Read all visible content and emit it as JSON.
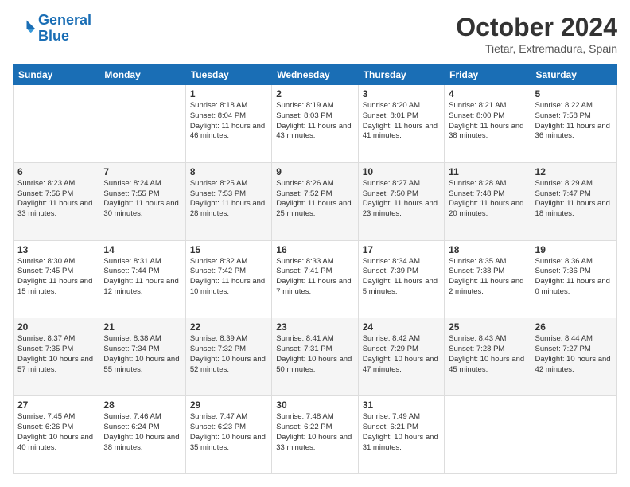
{
  "header": {
    "logo_line1": "General",
    "logo_line2": "Blue",
    "month_title": "October 2024",
    "subtitle": "Tietar, Extremadura, Spain"
  },
  "weekdays": [
    "Sunday",
    "Monday",
    "Tuesday",
    "Wednesday",
    "Thursday",
    "Friday",
    "Saturday"
  ],
  "weeks": [
    [
      {
        "day": "",
        "content": ""
      },
      {
        "day": "",
        "content": ""
      },
      {
        "day": "1",
        "content": "Sunrise: 8:18 AM\nSunset: 8:04 PM\nDaylight: 11 hours and 46 minutes."
      },
      {
        "day": "2",
        "content": "Sunrise: 8:19 AM\nSunset: 8:03 PM\nDaylight: 11 hours and 43 minutes."
      },
      {
        "day": "3",
        "content": "Sunrise: 8:20 AM\nSunset: 8:01 PM\nDaylight: 11 hours and 41 minutes."
      },
      {
        "day": "4",
        "content": "Sunrise: 8:21 AM\nSunset: 8:00 PM\nDaylight: 11 hours and 38 minutes."
      },
      {
        "day": "5",
        "content": "Sunrise: 8:22 AM\nSunset: 7:58 PM\nDaylight: 11 hours and 36 minutes."
      }
    ],
    [
      {
        "day": "6",
        "content": "Sunrise: 8:23 AM\nSunset: 7:56 PM\nDaylight: 11 hours and 33 minutes."
      },
      {
        "day": "7",
        "content": "Sunrise: 8:24 AM\nSunset: 7:55 PM\nDaylight: 11 hours and 30 minutes."
      },
      {
        "day": "8",
        "content": "Sunrise: 8:25 AM\nSunset: 7:53 PM\nDaylight: 11 hours and 28 minutes."
      },
      {
        "day": "9",
        "content": "Sunrise: 8:26 AM\nSunset: 7:52 PM\nDaylight: 11 hours and 25 minutes."
      },
      {
        "day": "10",
        "content": "Sunrise: 8:27 AM\nSunset: 7:50 PM\nDaylight: 11 hours and 23 minutes."
      },
      {
        "day": "11",
        "content": "Sunrise: 8:28 AM\nSunset: 7:48 PM\nDaylight: 11 hours and 20 minutes."
      },
      {
        "day": "12",
        "content": "Sunrise: 8:29 AM\nSunset: 7:47 PM\nDaylight: 11 hours and 18 minutes."
      }
    ],
    [
      {
        "day": "13",
        "content": "Sunrise: 8:30 AM\nSunset: 7:45 PM\nDaylight: 11 hours and 15 minutes."
      },
      {
        "day": "14",
        "content": "Sunrise: 8:31 AM\nSunset: 7:44 PM\nDaylight: 11 hours and 12 minutes."
      },
      {
        "day": "15",
        "content": "Sunrise: 8:32 AM\nSunset: 7:42 PM\nDaylight: 11 hours and 10 minutes."
      },
      {
        "day": "16",
        "content": "Sunrise: 8:33 AM\nSunset: 7:41 PM\nDaylight: 11 hours and 7 minutes."
      },
      {
        "day": "17",
        "content": "Sunrise: 8:34 AM\nSunset: 7:39 PM\nDaylight: 11 hours and 5 minutes."
      },
      {
        "day": "18",
        "content": "Sunrise: 8:35 AM\nSunset: 7:38 PM\nDaylight: 11 hours and 2 minutes."
      },
      {
        "day": "19",
        "content": "Sunrise: 8:36 AM\nSunset: 7:36 PM\nDaylight: 11 hours and 0 minutes."
      }
    ],
    [
      {
        "day": "20",
        "content": "Sunrise: 8:37 AM\nSunset: 7:35 PM\nDaylight: 10 hours and 57 minutes."
      },
      {
        "day": "21",
        "content": "Sunrise: 8:38 AM\nSunset: 7:34 PM\nDaylight: 10 hours and 55 minutes."
      },
      {
        "day": "22",
        "content": "Sunrise: 8:39 AM\nSunset: 7:32 PM\nDaylight: 10 hours and 52 minutes."
      },
      {
        "day": "23",
        "content": "Sunrise: 8:41 AM\nSunset: 7:31 PM\nDaylight: 10 hours and 50 minutes."
      },
      {
        "day": "24",
        "content": "Sunrise: 8:42 AM\nSunset: 7:29 PM\nDaylight: 10 hours and 47 minutes."
      },
      {
        "day": "25",
        "content": "Sunrise: 8:43 AM\nSunset: 7:28 PM\nDaylight: 10 hours and 45 minutes."
      },
      {
        "day": "26",
        "content": "Sunrise: 8:44 AM\nSunset: 7:27 PM\nDaylight: 10 hours and 42 minutes."
      }
    ],
    [
      {
        "day": "27",
        "content": "Sunrise: 7:45 AM\nSunset: 6:26 PM\nDaylight: 10 hours and 40 minutes."
      },
      {
        "day": "28",
        "content": "Sunrise: 7:46 AM\nSunset: 6:24 PM\nDaylight: 10 hours and 38 minutes."
      },
      {
        "day": "29",
        "content": "Sunrise: 7:47 AM\nSunset: 6:23 PM\nDaylight: 10 hours and 35 minutes."
      },
      {
        "day": "30",
        "content": "Sunrise: 7:48 AM\nSunset: 6:22 PM\nDaylight: 10 hours and 33 minutes."
      },
      {
        "day": "31",
        "content": "Sunrise: 7:49 AM\nSunset: 6:21 PM\nDaylight: 10 hours and 31 minutes."
      },
      {
        "day": "",
        "content": ""
      },
      {
        "day": "",
        "content": ""
      }
    ]
  ]
}
